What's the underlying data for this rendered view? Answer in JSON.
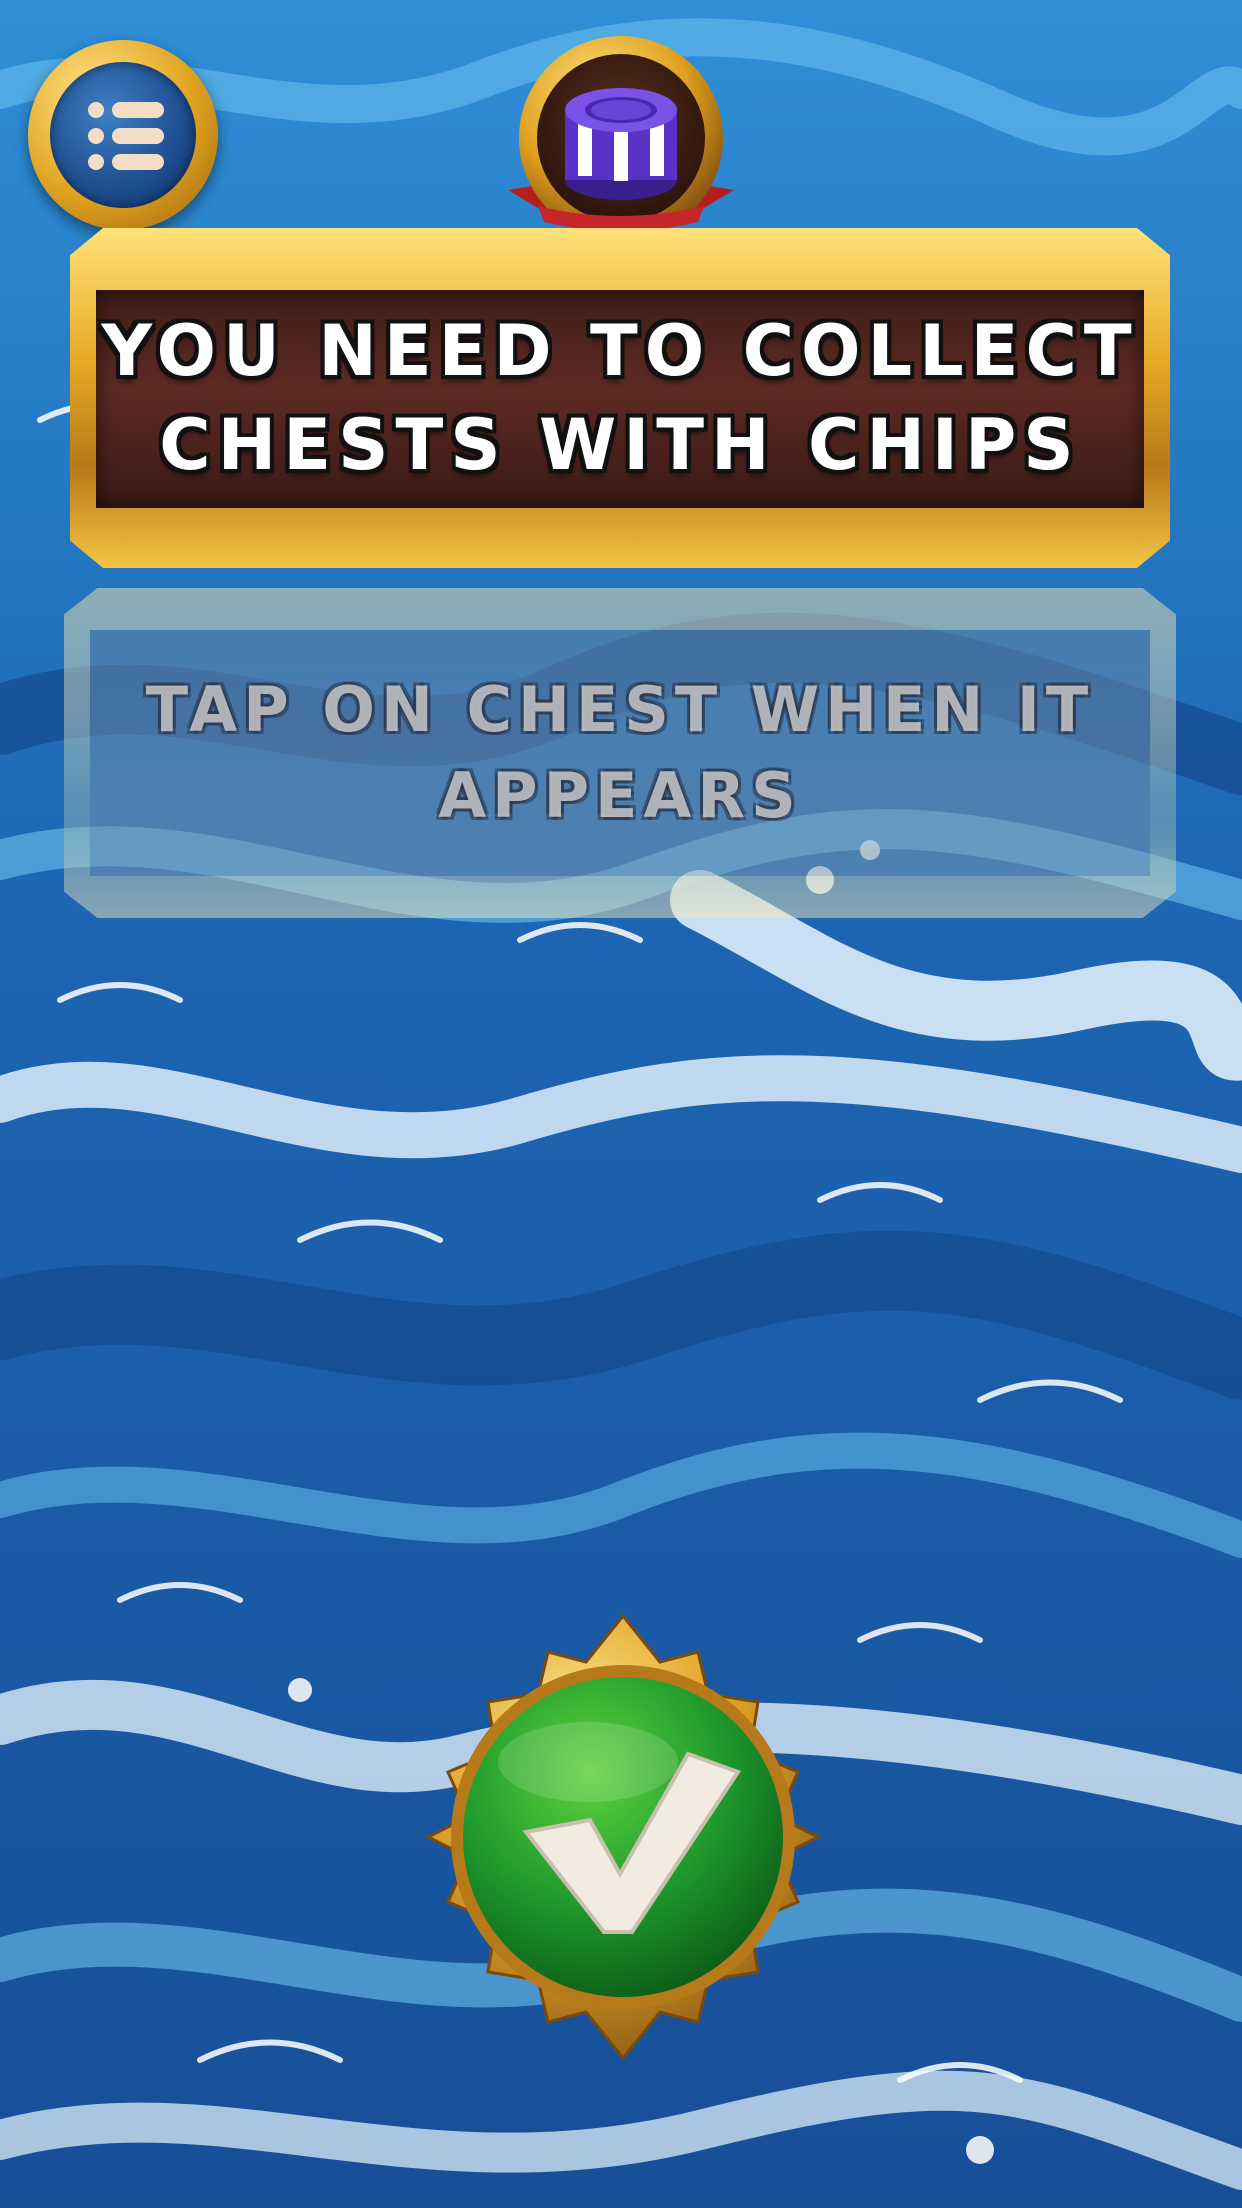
{
  "title": {
    "line1": "YOU NEED TO COLLECT",
    "line2": "CHESTS WITH CHIPS"
  },
  "hint": {
    "line1": "TAP ON CHEST WHEN IT",
    "line2": "APPEARS"
  },
  "icons": {
    "menu": "menu-list-icon",
    "chip": "casino-chip-stack-icon",
    "confirm": "checkmark-icon"
  },
  "colors": {
    "gold": "#e7a823",
    "banner_panel": "#4a211b",
    "confirm_green": "#1f9a2c",
    "ocean": "#1d5fa8"
  }
}
